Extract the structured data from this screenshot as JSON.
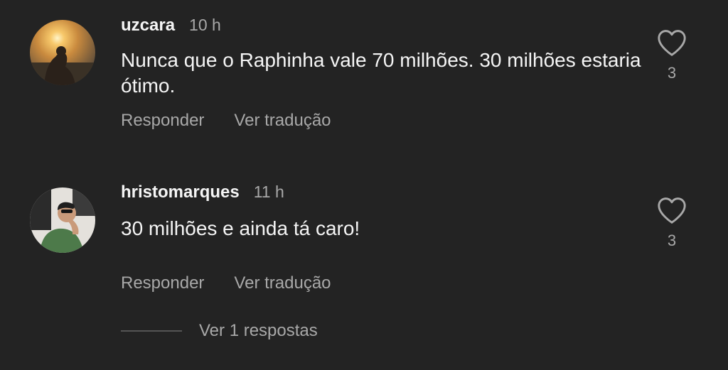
{
  "colors": {
    "background": "#232323",
    "primary_text": "#f5f5f5",
    "secondary_text": "#a8a8a8",
    "divider": "#555555"
  },
  "comments": [
    {
      "username": "uzcara",
      "time": "10 h",
      "text": "Nunca que o Raphinha vale 70 milhões. 30 milhões estaria ótimo.",
      "reply_label": "Responder",
      "translate_label": "Ver tradução",
      "like_icon": "heart-outline-icon",
      "likes": "3"
    },
    {
      "username": "hristomarques",
      "time": "11 h",
      "text": "30 milhões e ainda tá caro!",
      "reply_label": "Responder",
      "translate_label": "Ver tradução",
      "like_icon": "heart-outline-icon",
      "likes": "3"
    }
  ],
  "replies_toggle": {
    "label": "Ver 1 respostas"
  }
}
